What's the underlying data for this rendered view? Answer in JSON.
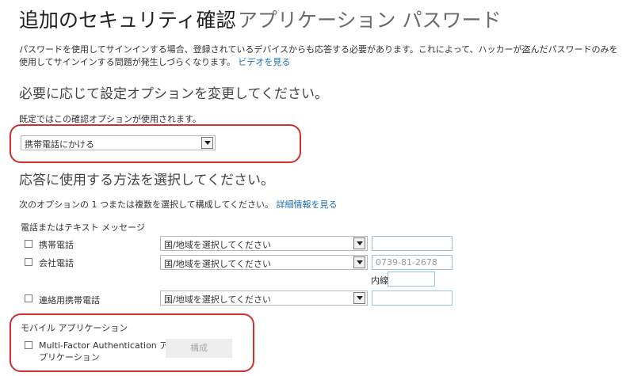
{
  "header": {
    "title": "追加のセキュリティ確認",
    "tab_app_password": "アプリケーション パスワード"
  },
  "description": {
    "text": "パスワードを使用してサインインする場合、登録されているデバイスからも応答する必要があります。これによって、ハッカーが盗んだパスワードのみを使用してサインインする問題が発生しづらくなります。",
    "video_link": "ビデオを見る"
  },
  "default_section": {
    "heading": "必要に応じて設定オプションを変更してください。",
    "note": "既定ではこの確認オプションが使用されます。",
    "selected_option": "携帯電話にかける"
  },
  "response_section": {
    "heading": "応答に使用する方法を選択してください。",
    "note": "次のオプションの 1 つまたは複数を選択して構成してください。",
    "details_link": "詳細情報を見る",
    "phone_group_label": "電話またはテキスト メッセージ",
    "rows": [
      {
        "label": "携帯電話",
        "country": "国/地域を選択してください",
        "number": ""
      },
      {
        "label": "会社電話",
        "country": "国/地域を選択してください",
        "number": "0739-81-2678",
        "extension_label": "内線",
        "extension": ""
      },
      {
        "label": "連絡用携帯電話",
        "country": "国/地域を選択してください",
        "number": ""
      }
    ],
    "mobile_app": {
      "group_label": "モバイル アプリケーション",
      "label_line1": "Multi-Factor Authentication ア",
      "label_line2": "プリケーション",
      "configure_button": "構成"
    }
  },
  "colors": {
    "link": "#1a6fb5",
    "highlight_border": "#d32f2f",
    "textbox_border": "#9fc3de"
  }
}
